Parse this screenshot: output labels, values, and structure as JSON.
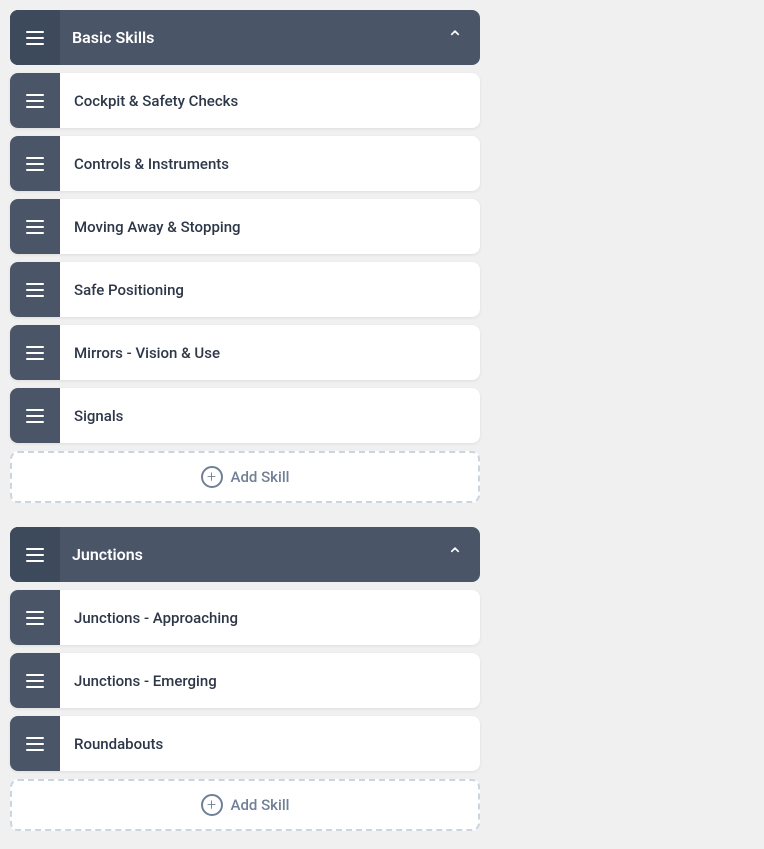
{
  "sections": [
    {
      "id": "basic-skills",
      "title": "Basic Skills",
      "expanded": true,
      "skills": [
        {
          "id": "cockpit-safety",
          "label": "Cockpit & Safety Checks"
        },
        {
          "id": "controls-instruments",
          "label": "Controls & Instruments"
        },
        {
          "id": "moving-away",
          "label": "Moving Away & Stopping"
        },
        {
          "id": "safe-positioning",
          "label": "Safe Positioning"
        },
        {
          "id": "mirrors-vision",
          "label": "Mirrors - Vision & Use"
        },
        {
          "id": "signals",
          "label": "Signals"
        }
      ],
      "add_skill_label": "Add Skill"
    },
    {
      "id": "junctions",
      "title": "Junctions",
      "expanded": true,
      "skills": [
        {
          "id": "junctions-approaching",
          "label": "Junctions - Approaching"
        },
        {
          "id": "junctions-emerging",
          "label": "Junctions - Emerging"
        },
        {
          "id": "roundabouts",
          "label": "Roundabouts"
        }
      ],
      "add_skill_label": "Add Skill"
    }
  ],
  "icons": {
    "hamburger": "hamburger",
    "chevron_up": "chevron-up",
    "plus": "plus"
  }
}
